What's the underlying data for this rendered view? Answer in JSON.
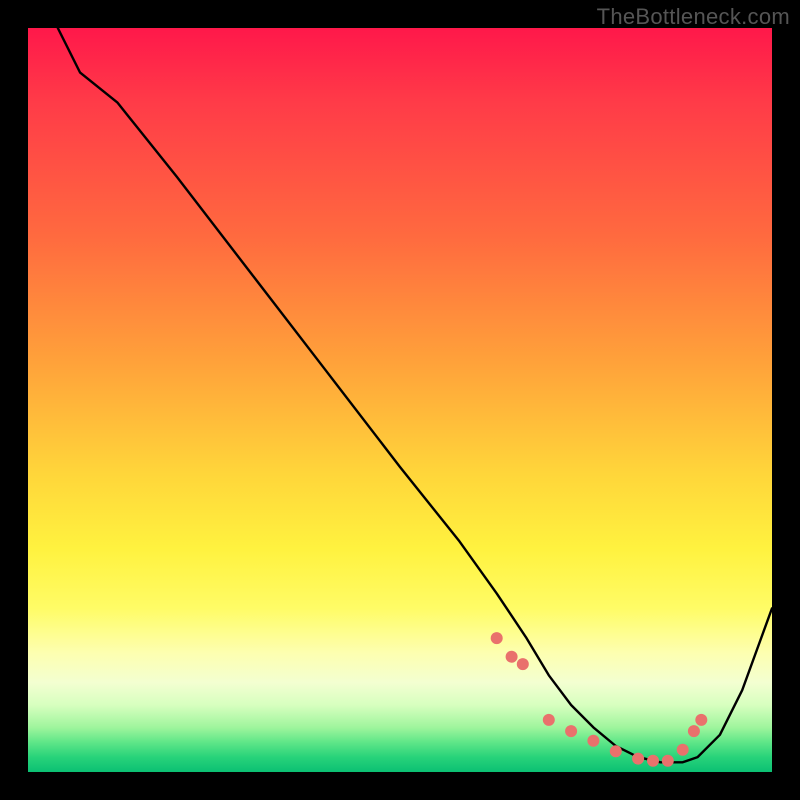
{
  "watermark": "TheBottleneck.com",
  "chart_data": {
    "type": "line",
    "title": "",
    "xlabel": "",
    "ylabel": "",
    "xlim": [
      0,
      100
    ],
    "ylim": [
      0,
      100
    ],
    "series": [
      {
        "name": "curve",
        "x": [
          4,
          7,
          12,
          20,
          30,
          40,
          50,
          58,
          63,
          67,
          70,
          73,
          76,
          79,
          82,
          85,
          88,
          90,
          93,
          96,
          100
        ],
        "y": [
          100,
          94,
          90,
          80,
          67,
          54,
          41,
          31,
          24,
          18,
          13,
          9,
          6,
          3.5,
          2,
          1.3,
          1.3,
          2,
          5,
          11,
          22
        ]
      }
    ],
    "markers": {
      "name": "dots",
      "x": [
        63,
        65,
        66.5,
        70,
        73,
        76,
        79,
        82,
        84,
        86,
        88,
        89.5,
        90.5
      ],
      "y": [
        18,
        15.5,
        14.5,
        7,
        5.5,
        4.2,
        2.8,
        1.8,
        1.5,
        1.5,
        3,
        5.5,
        7
      ],
      "color": "#e9716c",
      "radius": 6
    },
    "gradient_stops": [
      {
        "pos": 0,
        "color": "#ff184a"
      },
      {
        "pos": 28,
        "color": "#ff6a3f"
      },
      {
        "pos": 60,
        "color": "#ffd63a"
      },
      {
        "pos": 84,
        "color": "#fdffb0"
      },
      {
        "pos": 96,
        "color": "#5fe688"
      },
      {
        "pos": 100,
        "color": "#0bc073"
      }
    ]
  }
}
